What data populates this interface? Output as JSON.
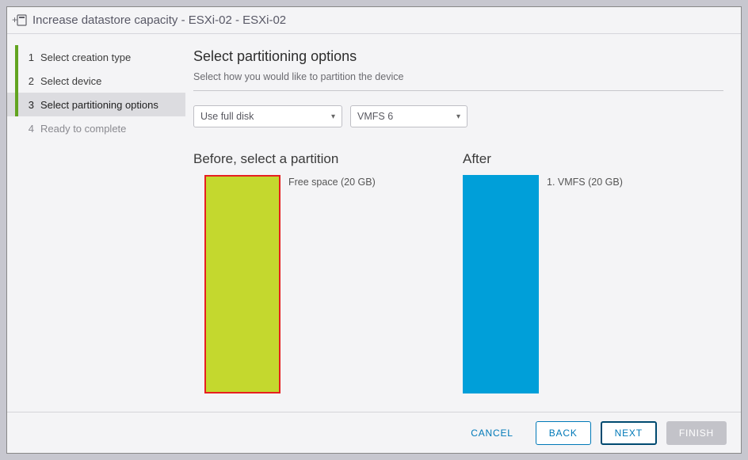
{
  "window": {
    "title": "Increase datastore capacity - ESXi-02 - ESXi-02"
  },
  "steps": [
    {
      "num": "1",
      "label": "Select creation type"
    },
    {
      "num": "2",
      "label": "Select device"
    },
    {
      "num": "3",
      "label": "Select partitioning options"
    },
    {
      "num": "4",
      "label": "Ready to complete"
    }
  ],
  "content": {
    "heading": "Select partitioning options",
    "subtitle": "Select how you would like to partition the device",
    "disk_usage_selected": "Use full disk",
    "fs_selected": "VMFS 6",
    "before_heading": "Before, select a partition",
    "before_label": "Free space  (20 GB)",
    "after_heading": "After",
    "after_label": "1. VMFS  (20 GB)"
  },
  "buttons": {
    "cancel": "CANCEL",
    "back": "BACK",
    "next": "NEXT",
    "finish": "FINISH"
  }
}
